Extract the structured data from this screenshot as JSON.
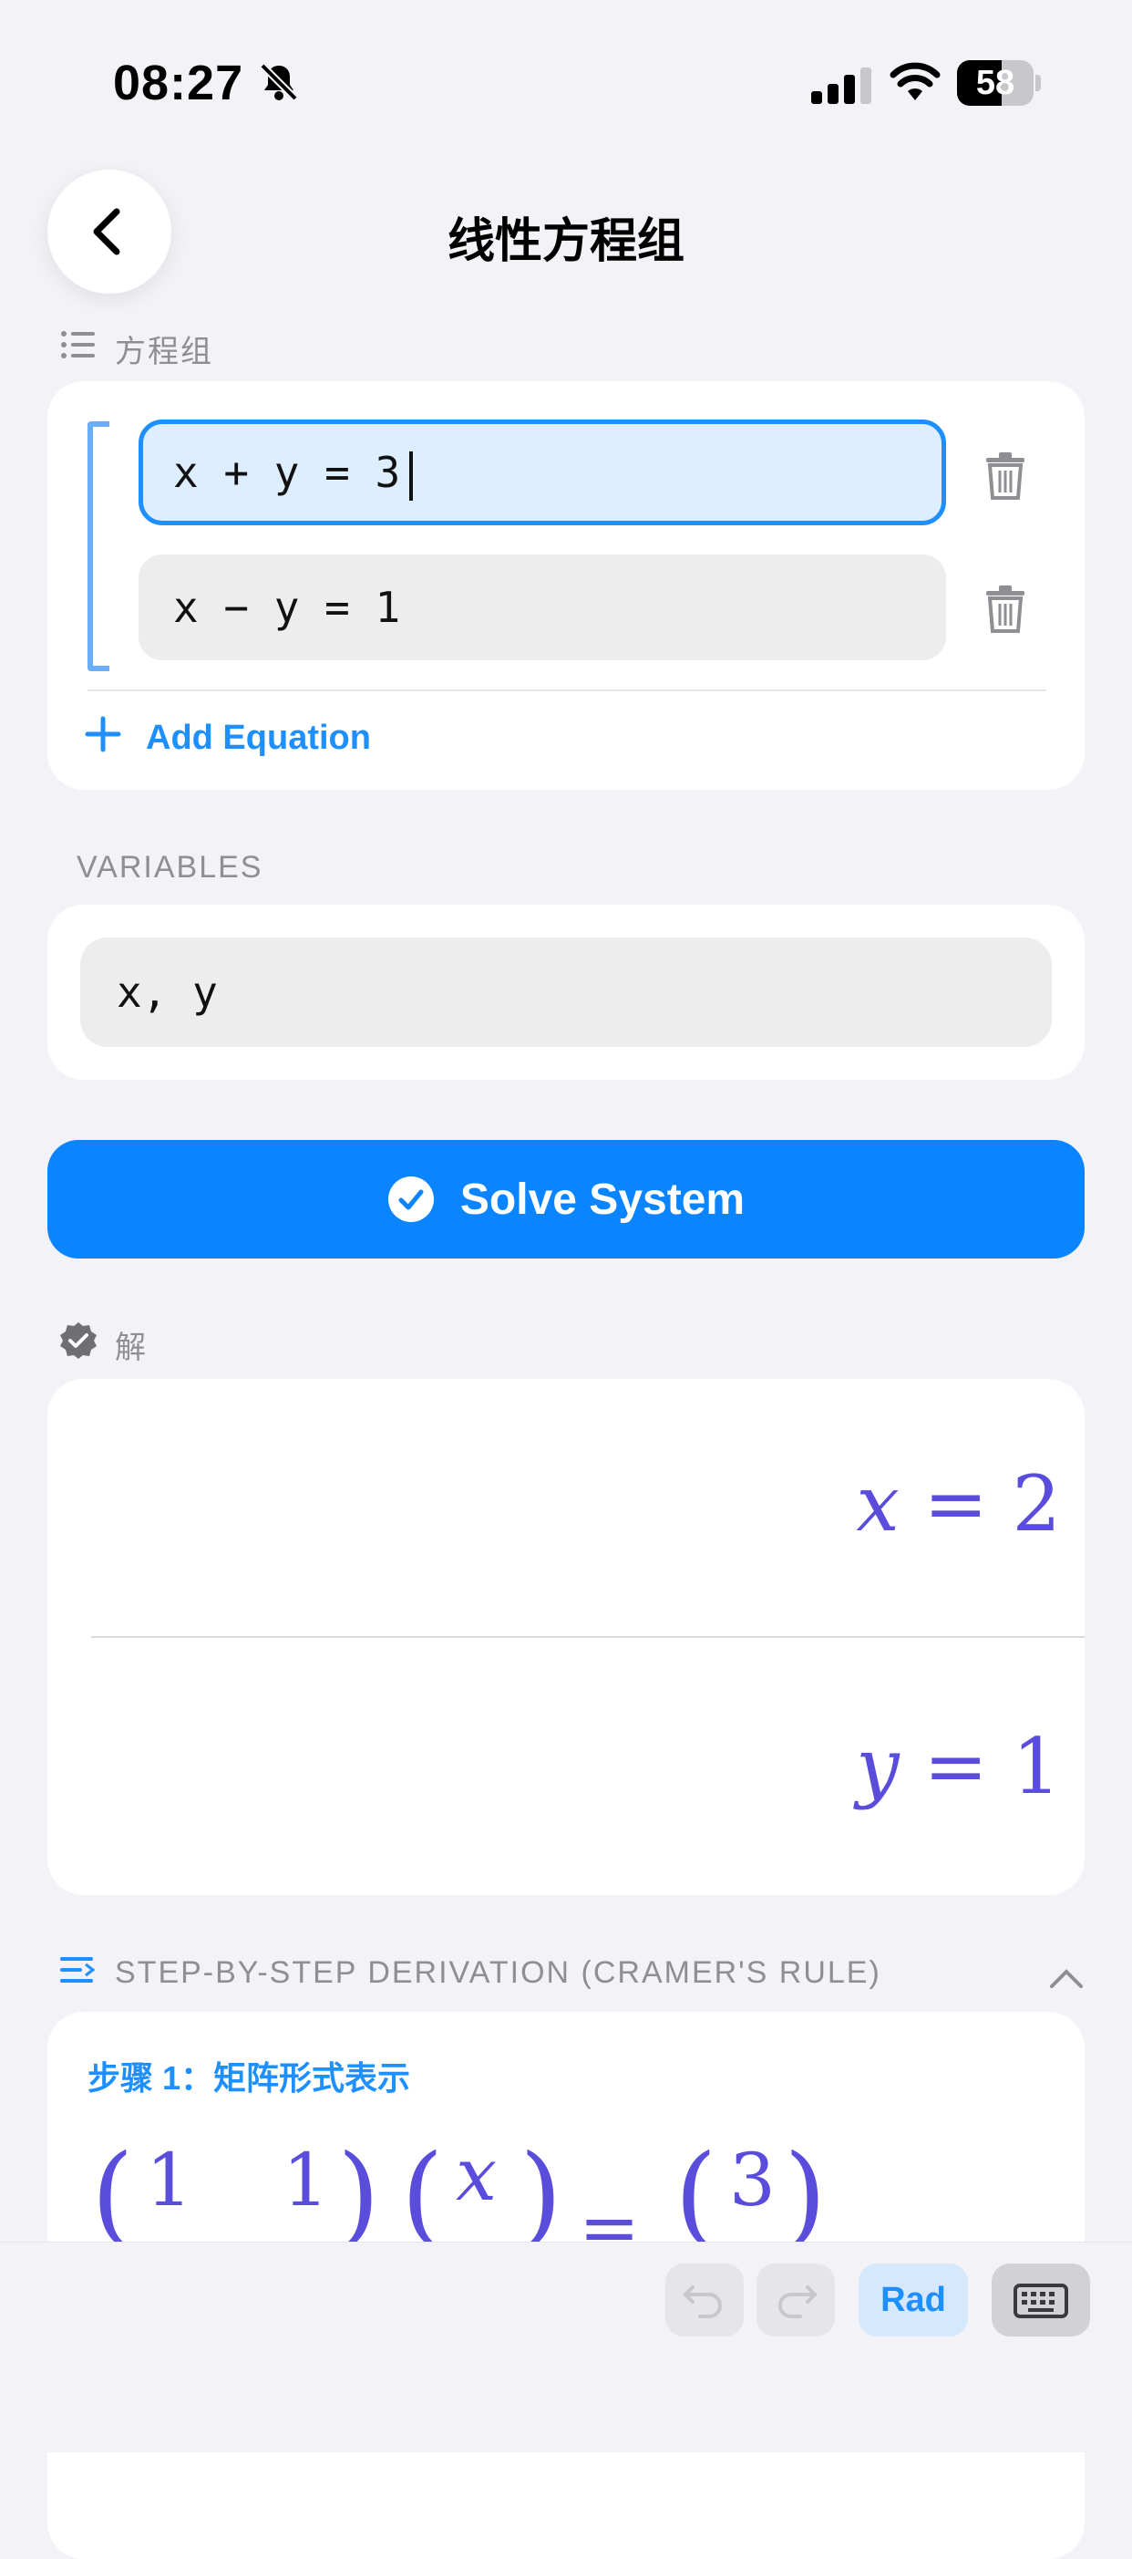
{
  "status": {
    "time": "08:27",
    "battery": "58"
  },
  "nav": {
    "title": "线性方程组"
  },
  "equations": {
    "label": "方程组",
    "items": [
      {
        "text": "x + y = 3"
      },
      {
        "text": "x − y = 1"
      }
    ],
    "add_label": "Add Equation"
  },
  "variables": {
    "label": "VARIABLES",
    "value": "x, y"
  },
  "solve": {
    "label": "Solve System"
  },
  "solution": {
    "label": "解",
    "items": [
      {
        "var": "x",
        "eq": "=",
        "value": "2"
      },
      {
        "var": "y",
        "eq": "=",
        "value": "1"
      }
    ]
  },
  "steps": {
    "label": "STEP-BY-STEP DERIVATION (CRAMER'S RULE)",
    "step1_title": "步骤 1：矩阵形式表示",
    "matrix": {
      "a11": "1",
      "a12": "1",
      "v1": "x",
      "b1": "3",
      "eq": "="
    }
  },
  "toolbar": {
    "mode": "Rad"
  },
  "colors": {
    "accent": "#0A84FF",
    "math": "#5A4DDC",
    "field_active_bg": "#DCEEFF"
  }
}
